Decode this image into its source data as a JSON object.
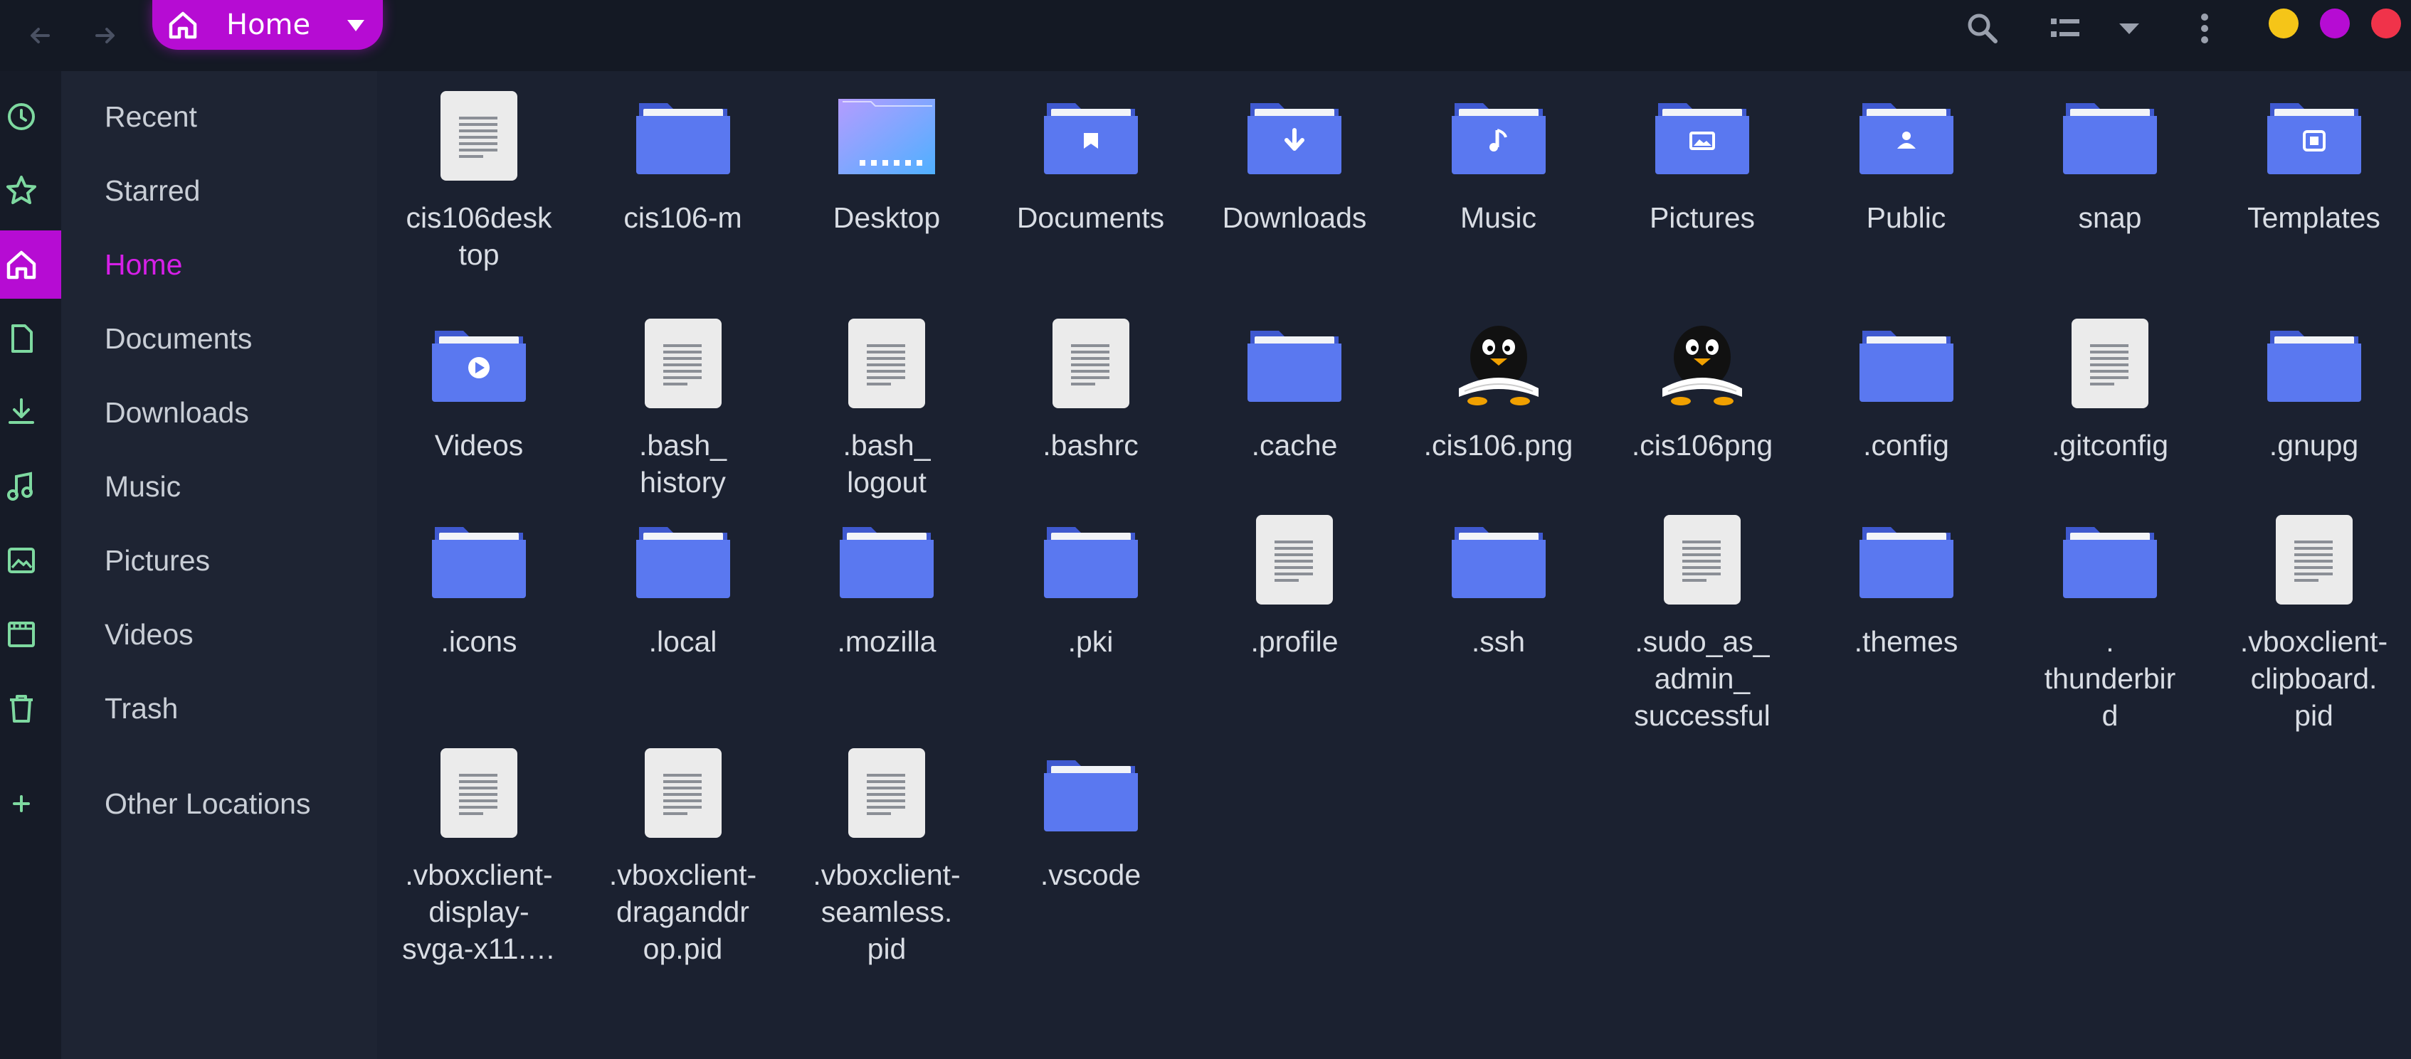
{
  "header": {
    "path_label": "Home",
    "accent_color": "#b60cd3",
    "window_buttons": [
      {
        "name": "minimize-button",
        "color": "#f5c518"
      },
      {
        "name": "maximize-button",
        "color": "#b60cd3"
      },
      {
        "name": "close-button",
        "color": "#f0334a"
      }
    ]
  },
  "sidebar": {
    "items": [
      {
        "label": "Recent",
        "icon": "clock-icon"
      },
      {
        "label": "Starred",
        "icon": "star-icon"
      },
      {
        "label": "Home",
        "icon": "home-icon",
        "active": true
      },
      {
        "label": "Documents",
        "icon": "document-icon"
      },
      {
        "label": "Downloads",
        "icon": "download-icon"
      },
      {
        "label": "Music",
        "icon": "music-icon"
      },
      {
        "label": "Pictures",
        "icon": "picture-icon"
      },
      {
        "label": "Videos",
        "icon": "video-icon"
      },
      {
        "label": "Trash",
        "icon": "trash-icon"
      },
      {
        "label": "Other Locations",
        "icon": "plus-icon"
      }
    ]
  },
  "files": [
    {
      "name": "cis106desk\ntop",
      "kind": "file"
    },
    {
      "name": "cis106-m",
      "kind": "folder"
    },
    {
      "name": "Desktop",
      "kind": "desktop"
    },
    {
      "name": "Documents",
      "kind": "folder",
      "emblem": "doc"
    },
    {
      "name": "Downloads",
      "kind": "folder",
      "emblem": "download"
    },
    {
      "name": "Music",
      "kind": "folder",
      "emblem": "music"
    },
    {
      "name": "Pictures",
      "kind": "folder",
      "emblem": "picture"
    },
    {
      "name": "Public",
      "kind": "folder",
      "emblem": "person"
    },
    {
      "name": "snap",
      "kind": "folder"
    },
    {
      "name": "Templates",
      "kind": "folder",
      "emblem": "template"
    },
    {
      "name": "Videos",
      "kind": "folder",
      "emblem": "play"
    },
    {
      "name": ".bash_\nhistory",
      "kind": "file"
    },
    {
      "name": ".bash_\nlogout",
      "kind": "file"
    },
    {
      "name": ".bashrc",
      "kind": "file"
    },
    {
      "name": ".cache",
      "kind": "folder"
    },
    {
      "name": ".cis106.png",
      "kind": "image"
    },
    {
      "name": ".cis106png",
      "kind": "image"
    },
    {
      "name": ".config",
      "kind": "folder"
    },
    {
      "name": ".gitconfig",
      "kind": "file"
    },
    {
      "name": ".gnupg",
      "kind": "folder"
    },
    {
      "name": ".icons",
      "kind": "folder"
    },
    {
      "name": ".local",
      "kind": "folder"
    },
    {
      "name": ".mozilla",
      "kind": "folder"
    },
    {
      "name": ".pki",
      "kind": "folder"
    },
    {
      "name": ".profile",
      "kind": "file"
    },
    {
      "name": ".ssh",
      "kind": "folder"
    },
    {
      "name": ".sudo_as_\nadmin_\nsuccessful",
      "kind": "file"
    },
    {
      "name": ".themes",
      "kind": "folder"
    },
    {
      "name": ".\nthunderbir\nd",
      "kind": "folder"
    },
    {
      "name": ".vboxclient-\nclipboard.\npid",
      "kind": "file"
    },
    {
      "name": ".vboxclient-\ndisplay-\nsvga-x11.…",
      "kind": "file"
    },
    {
      "name": ".vboxclient-\ndraganddr\nop.pid",
      "kind": "file"
    },
    {
      "name": ".vboxclient-\nseamless.\npid",
      "kind": "file"
    },
    {
      "name": ".vscode",
      "kind": "folder"
    }
  ]
}
